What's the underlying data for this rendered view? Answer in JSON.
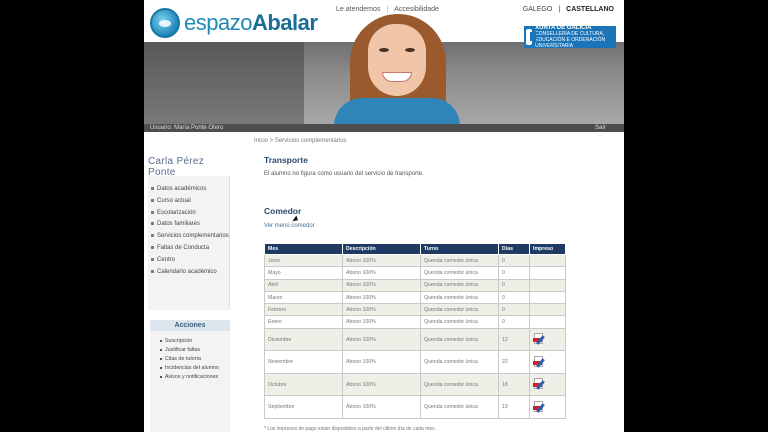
{
  "header": {
    "logo_prefix": "espazo",
    "logo_bold": "Abalar",
    "links": [
      "Le atendemos",
      "Accesibilidade"
    ],
    "languages": [
      "GALEGO",
      "CASTELLANO"
    ],
    "xunta_name": "XUNTA DE GALICIA",
    "xunta_dept": "CONSELLERÍA DE CULTURA, EDUCACIÓN E ORDENACIÓN UNIVERSITARIA",
    "user_bar": "Usuario: María Ponte Otero",
    "exit_label": "Saír"
  },
  "sidebar": {
    "student_name": "Carla Pérez Ponte",
    "items": [
      "Datos académicos",
      "Curso actual",
      "Escolarización",
      "Datos familiares",
      "Servicios complementarios",
      "Faltas de Conducta",
      "Centro",
      "Calendario académico"
    ],
    "actions_title": "Acciones",
    "actions": [
      "Suscripción",
      "Justificar faltas",
      "Citas de tutoría",
      "Incidencias del alumno",
      "Avisos y notificaciones"
    ]
  },
  "main": {
    "breadcrumb": "Inicio > Servicios complementarios",
    "transport_title": "Transporte",
    "transport_text": "El alumno no figura como usuario del servicio de transporte.",
    "comedor_title": "Comedor",
    "menu_link": "Ver menú comedor",
    "table": {
      "headers": [
        "Mes",
        "Descripción",
        "Turno",
        "Días",
        "Impreso"
      ],
      "rows": [
        {
          "mes": "Junio",
          "desc": "Abono 100%",
          "turno": "Quenda comedor única",
          "dias": "0",
          "pdf": false
        },
        {
          "mes": "Mayo",
          "desc": "Abono 100%",
          "turno": "Quenda comedor única",
          "dias": "0",
          "pdf": false
        },
        {
          "mes": "Abril",
          "desc": "Abono 100%",
          "turno": "Quenda comedor única",
          "dias": "0",
          "pdf": false
        },
        {
          "mes": "Marzo",
          "desc": "Abono 100%",
          "turno": "Quenda comedor única",
          "dias": "0",
          "pdf": false
        },
        {
          "mes": "Febrero",
          "desc": "Abono 100%",
          "turno": "Quenda comedor única",
          "dias": "0",
          "pdf": false
        },
        {
          "mes": "Enero",
          "desc": "Abono 100%",
          "turno": "Quenda comedor única",
          "dias": "0",
          "pdf": false
        },
        {
          "mes": "Diciembre",
          "desc": "Abono 100%",
          "turno": "Quenda comedor única",
          "dias": "12",
          "pdf": true
        },
        {
          "mes": "Noviembre",
          "desc": "Abono 100%",
          "turno": "Quenda comedor única",
          "dias": "22",
          "pdf": true
        },
        {
          "mes": "Octubre",
          "desc": "Abono 100%",
          "turno": "Quenda comedor única",
          "dias": "18",
          "pdf": true
        },
        {
          "mes": "Septiembre",
          "desc": "Abono 100%",
          "turno": "Quenda comedor única",
          "dias": "19",
          "pdf": true
        }
      ]
    },
    "footnote": "* Los impresos de pago están disponibles a partir del último día de cada mes."
  }
}
